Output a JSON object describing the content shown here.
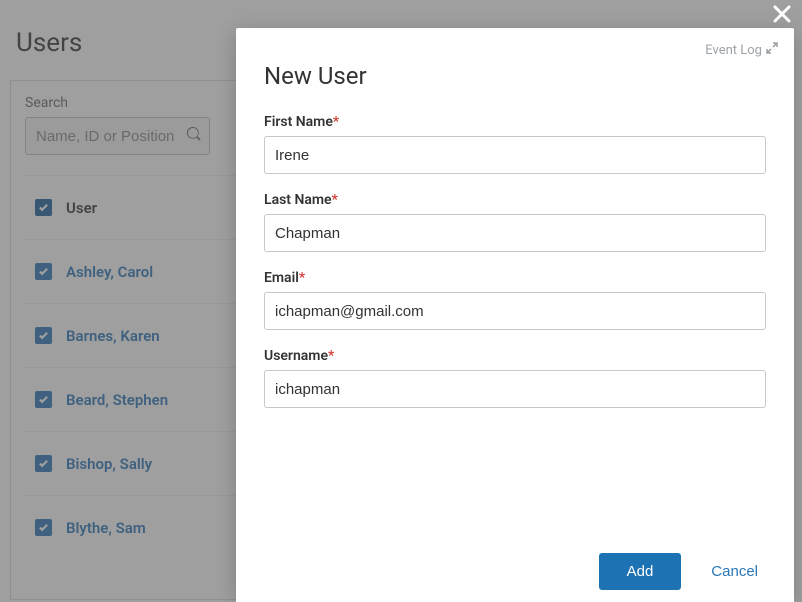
{
  "page": {
    "title": "Users",
    "search_label": "Search",
    "search_placeholder": "Name, ID or Position"
  },
  "table": {
    "header": "User",
    "rows": [
      {
        "name": "Ashley, Carol",
        "checked": true
      },
      {
        "name": "Barnes, Karen",
        "checked": true
      },
      {
        "name": "Beard, Stephen",
        "checked": true
      },
      {
        "name": "Bishop, Sally",
        "checked": true
      },
      {
        "name": "Blythe, Sam",
        "checked": true
      }
    ]
  },
  "modal": {
    "title": "New User",
    "event_log": "Event Log",
    "fields": {
      "first_name": {
        "label": "First Name",
        "value": "Irene",
        "required": true
      },
      "last_name": {
        "label": "Last Name",
        "value": "Chapman",
        "required": true
      },
      "email": {
        "label": "Email",
        "value": "ichapman@gmail.com",
        "required": true
      },
      "username": {
        "label": "Username",
        "value": "ichapman",
        "required": true
      }
    },
    "add_label": "Add",
    "cancel_label": "Cancel"
  }
}
